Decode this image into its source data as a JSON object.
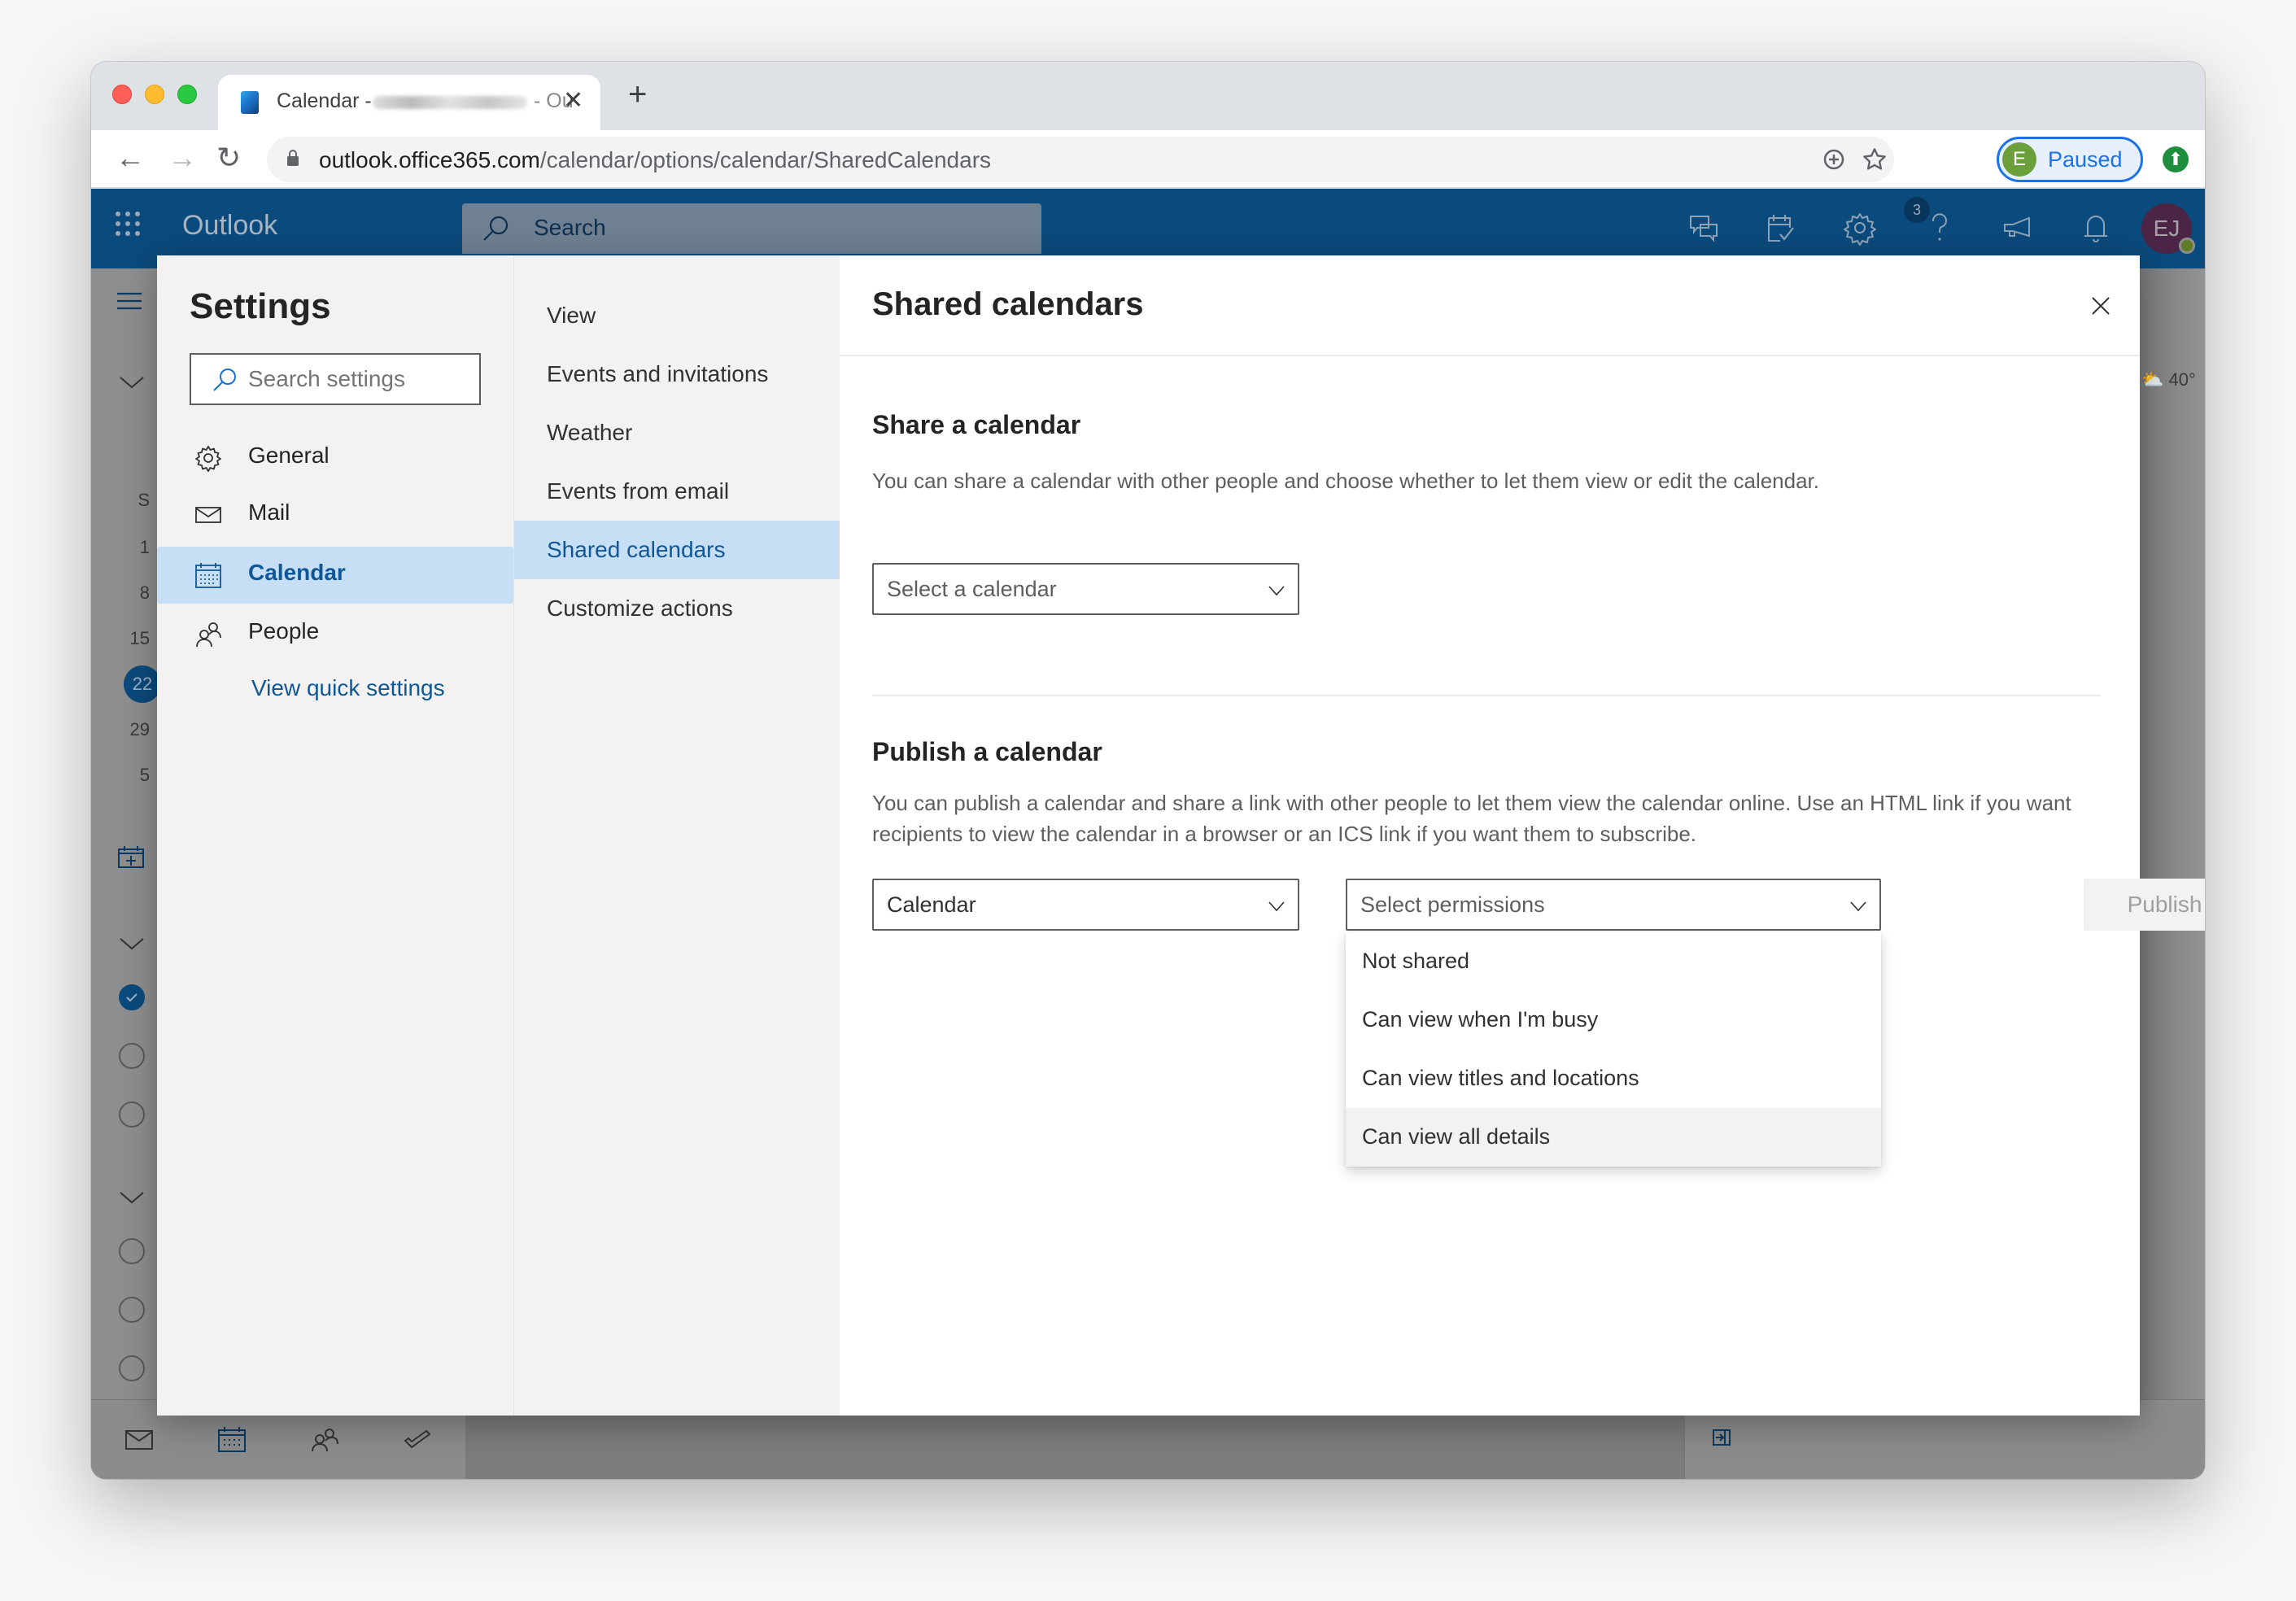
{
  "browser": {
    "tab": {
      "title_prefix": "Calendar - ",
      "title_suffix": "- Ou",
      "close_glyph": "✕",
      "new_tab_glyph": "+"
    },
    "nav": {
      "back": "←",
      "forward": "→",
      "reload": "↻"
    },
    "url": {
      "host": "outlook.office365.com",
      "path": "/calendar/options/calendar/SharedCalendars"
    },
    "profile": {
      "initial": "E",
      "status": "Paused"
    },
    "update_glyph": "⬆"
  },
  "outlook": {
    "brand": "Outlook",
    "search_label": "Search",
    "notification_badge": "3",
    "user_initials": "EJ",
    "header_icons": [
      "chat-icon",
      "my-day-icon",
      "settings-gear-icon",
      "help-icon",
      "feedback-megaphone-icon",
      "notifications-bell-icon"
    ]
  },
  "background": {
    "mini_calendar": {
      "weekday_header": "S",
      "week_starts": [
        "1",
        "8",
        "15",
        "22",
        "29",
        "5"
      ],
      "today": "22"
    },
    "weather": "40°",
    "calendar_list": {
      "groups": [
        {
          "items_checked": [
            true,
            false,
            false
          ]
        },
        {
          "items_checked": [
            false,
            false,
            false,
            false
          ]
        }
      ]
    }
  },
  "settings": {
    "title": "Settings",
    "search_placeholder": "Search settings",
    "categories": [
      {
        "label": "General",
        "icon": "gear-icon",
        "selected": false
      },
      {
        "label": "Mail",
        "icon": "mail-icon",
        "selected": false
      },
      {
        "label": "Calendar",
        "icon": "calendar-icon",
        "selected": true
      },
      {
        "label": "People",
        "icon": "people-icon",
        "selected": false
      }
    ],
    "quick_settings_link": "View quick settings",
    "subcategories": [
      {
        "label": "View",
        "selected": false
      },
      {
        "label": "Events and invitations",
        "selected": false
      },
      {
        "label": "Weather",
        "selected": false
      },
      {
        "label": "Events from email",
        "selected": false
      },
      {
        "label": "Shared calendars",
        "selected": true
      },
      {
        "label": "Customize actions",
        "selected": false
      }
    ]
  },
  "pane": {
    "title": "Shared calendars",
    "share": {
      "heading": "Share a calendar",
      "description": "You can share a calendar with other people and choose whether to let them view or edit the calendar.",
      "select_placeholder": "Select a calendar"
    },
    "publish": {
      "heading": "Publish a calendar",
      "description": "You can publish a calendar and share a link with other people to let them view the calendar online. Use an HTML link if you want recipients to view the calendar in a browser or an ICS link if you want them to subscribe.",
      "calendar_value": "Calendar",
      "permissions_placeholder": "Select permissions",
      "publish_label": "Publish",
      "publish_enabled": false,
      "permission_options": [
        "Not shared",
        "Can view when I'm busy",
        "Can view titles and locations",
        "Can view all details"
      ],
      "hovered_option": "Can view all details"
    }
  }
}
